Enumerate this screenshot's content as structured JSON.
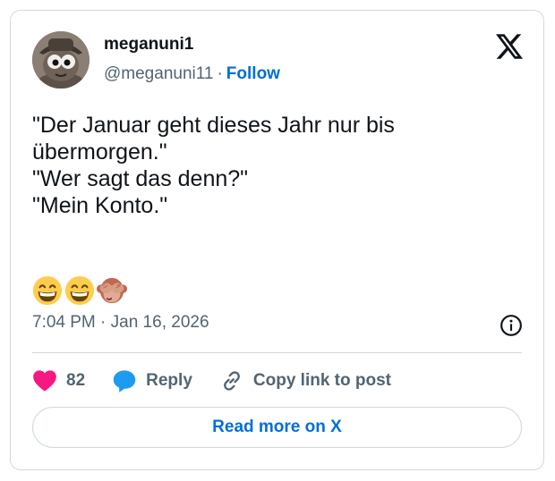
{
  "author": {
    "display_name": "meganuni1",
    "handle": "@meganuni11",
    "separator": "·",
    "follow_label": "Follow"
  },
  "tweet": {
    "lines": [
      "\"Der Januar geht dieses Jahr nur bis",
      "übermorgen.\"",
      "\"Wer sagt das denn?\"",
      "\"Mein Konto.\""
    ],
    "emojis": [
      "grinning-face-with-smiling-eyes",
      "grinning-face-with-smiling-eyes",
      "see-no-evil-monkey"
    ]
  },
  "meta": {
    "timestamp": "7:04 PM · Jan 16, 2026"
  },
  "actions": {
    "like_count": "82",
    "reply_label": "Reply",
    "copy_link_label": "Copy link to post"
  },
  "footer": {
    "read_more_label": "Read more on X"
  },
  "colors": {
    "link_blue": "#006fd6",
    "heart_pink": "#f91880",
    "reply_blue": "#1d9bf0",
    "muted_text": "#536471",
    "border": "#cfd9de"
  }
}
